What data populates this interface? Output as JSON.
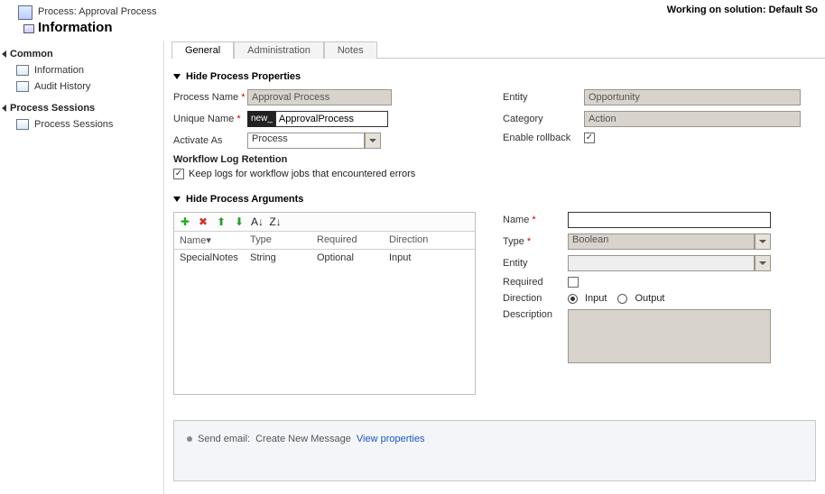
{
  "header": {
    "process_label": "Process: Approval Process",
    "info_label": "Information",
    "working_on": "Working on solution: Default So"
  },
  "sidebar": {
    "cat1": "Common",
    "cat1_items": [
      "Information",
      "Audit History"
    ],
    "cat2": "Process Sessions",
    "cat2_items": [
      "Process Sessions"
    ]
  },
  "tabs": [
    "General",
    "Administration",
    "Notes"
  ],
  "props": {
    "section": "Hide Process Properties",
    "process_name_label": "Process Name",
    "process_name_value": "Approval Process",
    "unique_name_label": "Unique Name",
    "unique_name_prefix": "new_",
    "unique_name_value": "ApprovalProcess",
    "activate_as_label": "Activate As",
    "activate_as_value": "Process",
    "workflow_log_heading": "Workflow Log Retention",
    "keep_logs_label": "Keep logs for workflow jobs that encountered errors",
    "entity_label": "Entity",
    "entity_value": "Opportunity",
    "category_label": "Category",
    "category_value": "Action",
    "enable_rollback_label": "Enable rollback"
  },
  "args": {
    "section": "Hide Process Arguments",
    "cols": {
      "name": "Name",
      "type": "Type",
      "required": "Required",
      "direction": "Direction"
    },
    "sort_suffix": "▾",
    "rows": [
      {
        "name": "SpecialNotes",
        "type": "String",
        "required": "Optional",
        "direction": "Input"
      }
    ],
    "form": {
      "name_label": "Name",
      "type_label": "Type",
      "type_value": "Boolean",
      "entity_label": "Entity",
      "required_label": "Required",
      "direction_label": "Direction",
      "direction_input": "Input",
      "direction_output": "Output",
      "description_label": "Description"
    }
  },
  "steps": {
    "line_prefix": "Send email:",
    "line_value": "Create New Message",
    "view_props": "View properties"
  }
}
